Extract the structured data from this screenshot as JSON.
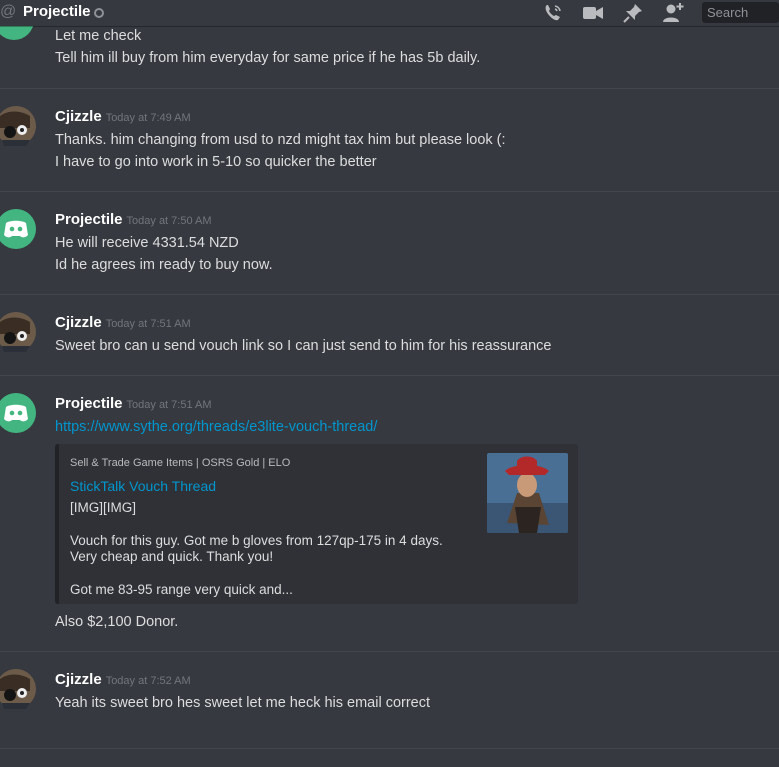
{
  "header": {
    "channel_name": "Projectile",
    "search_placeholder": "Search",
    "icons": [
      "at-icon",
      "status-dot-icon",
      "call-icon",
      "video-icon",
      "pin-icon",
      "add-user-icon"
    ]
  },
  "messages": [
    {
      "author": "",
      "time": "",
      "lines": [
        "Let me check",
        "Tell him ill buy from him everyday for same price if he has 5b daily."
      ]
    },
    {
      "author": "Cjizzle",
      "time": "Today at 7:49 AM",
      "lines": [
        "Thanks. him changing from usd to nzd might tax him but please look (:",
        "I have to go into work in 5-10 so quicker the better"
      ]
    },
    {
      "author": "Projectile",
      "time": "Today at 7:50 AM",
      "lines": [
        "He will receive 4331.54 NZD",
        "Id he agrees im ready to buy now."
      ]
    },
    {
      "author": "Cjizzle",
      "time": "Today at 7:51 AM",
      "lines": [
        "Sweet bro can u send vouch link so I can just send to him for his reassurance"
      ]
    },
    {
      "author": "Projectile",
      "time": "Today at 7:51 AM",
      "link": "https://www.sythe.org/threads/e3lite-vouch-thread/",
      "after_embed": "Also $2,100 Donor."
    },
    {
      "author": "Cjizzle",
      "time": "Today at 7:52 AM",
      "lines": [
        "Yeah its sweet bro hes sweet let me  heck his email correct"
      ]
    }
  ],
  "embed": {
    "provider": "Sell & Trade Game Items | OSRS Gold | ELO",
    "title": "StickTalk Vouch Thread",
    "description": [
      "[IMG][IMG]",
      "Vouch for this guy. Got me b gloves from 127qp-175 in 4 days. Very cheap and quick. Thank you!",
      "Got me 83-95 range very quick and..."
    ]
  },
  "colors": {
    "background": "#36393f",
    "link": "#0096cf",
    "discord_blurple_avatar": "#43b581",
    "embed_bg": "#2f3136"
  }
}
